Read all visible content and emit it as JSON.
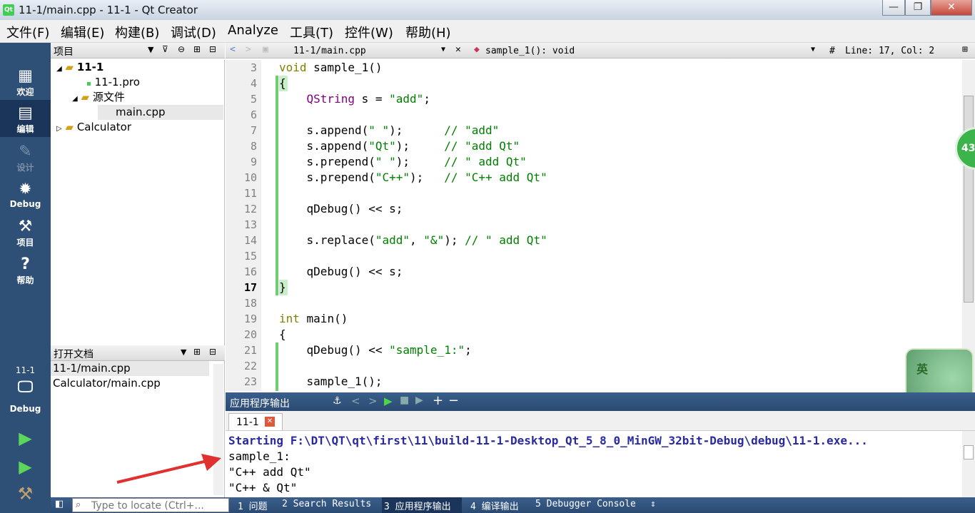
{
  "window": {
    "title": "11-1/main.cpp - 11-1 - Qt Creator",
    "logo": "Qt",
    "minimize": "—",
    "maximize": "❐",
    "close": "✕"
  },
  "menu": [
    "文件(F)",
    "编辑(E)",
    "构建(B)",
    "调试(D)",
    "Analyze",
    "工具(T)",
    "控件(W)",
    "帮助(H)"
  ],
  "modes": [
    {
      "label": "欢迎",
      "icon": "grid-icon"
    },
    {
      "label": "编辑",
      "icon": "document-icon"
    },
    {
      "label": "设计",
      "icon": "pencil-icon"
    },
    {
      "label": "Debug",
      "icon": "bug-icon"
    },
    {
      "label": "项目",
      "icon": "wrench-icon"
    },
    {
      "label": "帮助",
      "icon": "help-icon"
    }
  ],
  "kit": {
    "project": "11-1",
    "config": "Debug"
  },
  "projects_panel": {
    "title": "项目",
    "items": [
      {
        "label": "11-1",
        "level": 0,
        "expanded": true,
        "bold": true
      },
      {
        "label": "11-1.pro",
        "level": 1
      },
      {
        "label": "源文件",
        "level": 1,
        "expanded": true
      },
      {
        "label": "main.cpp",
        "level": 2,
        "selected": true
      },
      {
        "label": "Calculator",
        "level": 0,
        "expanded": false
      }
    ]
  },
  "open_docs": {
    "title": "打开文档",
    "items": [
      "11-1/main.cpp",
      "Calculator/main.cpp"
    ]
  },
  "editor_toolbar": {
    "file": "11-1/main.cpp",
    "symbol": "sample_1(): void",
    "hash": "#",
    "position": "Line: 17, Col: 2"
  },
  "code_lines": [
    {
      "n": "3",
      "html": "<span class=\"kw\">void</span> sample_1()"
    },
    {
      "n": "4",
      "html": "{"
    },
    {
      "n": "5",
      "html": "    <span class=\"ty\">QString</span> s = <span class=\"st\">\"add\"</span>;"
    },
    {
      "n": "6",
      "html": ""
    },
    {
      "n": "7",
      "html": "    s.append(<span class=\"st\">\" \"</span>);      <span class=\"cm\">// \"add\"</span>"
    },
    {
      "n": "8",
      "html": "    s.append(<span class=\"st\">\"Qt\"</span>);     <span class=\"cm\">// \"add Qt\"</span>"
    },
    {
      "n": "9",
      "html": "    s.prepend(<span class=\"st\">\" \"</span>);     <span class=\"cm\">// \" add Qt\"</span>"
    },
    {
      "n": "10",
      "html": "    s.prepend(<span class=\"st\">\"C++\"</span>);   <span class=\"cm\">// \"C++ add Qt\"</span>"
    },
    {
      "n": "11",
      "html": ""
    },
    {
      "n": "12",
      "html": "    qDebug() &lt;&lt; s;"
    },
    {
      "n": "13",
      "html": ""
    },
    {
      "n": "14",
      "html": "    s.replace(<span class=\"st\">\"add\"</span>, <span class=\"st\">\"&amp;\"</span>); <span class=\"cm\">// \" add Qt\"</span>"
    },
    {
      "n": "15",
      "html": ""
    },
    {
      "n": "16",
      "html": "    qDebug() &lt;&lt; s;"
    },
    {
      "n": "17",
      "html": "}"
    },
    {
      "n": "18",
      "html": ""
    },
    {
      "n": "19",
      "html": "<span class=\"kw\">int</span> main()"
    },
    {
      "n": "20",
      "html": "{"
    },
    {
      "n": "21",
      "html": "    qDebug() &lt;&lt; <span class=\"st\">\"sample_1:\"</span>;"
    },
    {
      "n": "22",
      "html": ""
    },
    {
      "n": "23",
      "html": "    sample_1();"
    }
  ],
  "output_panel": {
    "title": "应用程序输出",
    "tab": "11-1",
    "lines": [
      "Starting F:\\DT\\QT\\qt\\first\\11\\build-11-1-Desktop_Qt_5_8_0_MinGW_32bit-Debug\\debug\\11-1.exe...",
      "sample_1:",
      "\"C++ add Qt\"",
      "\"C++ & Qt\""
    ]
  },
  "locator": {
    "placeholder": "Type to locate (Ctrl+..."
  },
  "bottom_tabs": [
    "1 问题",
    "2 Search Results",
    "3 应用程序输出",
    "4 编译输出",
    "5 Debugger Console"
  ],
  "badges": {
    "float_number": "43",
    "ime_label": "英"
  }
}
